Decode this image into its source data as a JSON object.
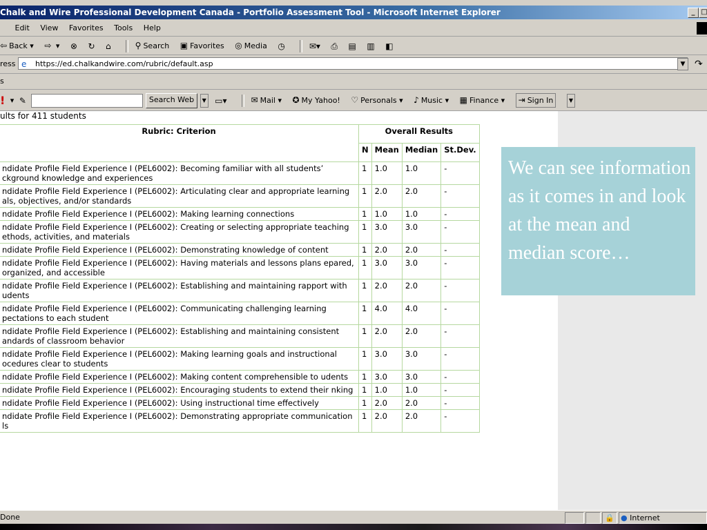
{
  "window": {
    "title": "Chalk and Wire Professional Development Canada - Portfolio Assessment Tool - Microsoft Internet Explorer",
    "minimize_label": "_",
    "restore_label": "□"
  },
  "menu": {
    "items": [
      "Edit",
      "View",
      "Favorites",
      "Tools",
      "Help"
    ]
  },
  "toolbar": {
    "back": "Back",
    "search": "Search",
    "favorites": "Favorites",
    "media": "Media"
  },
  "address": {
    "label": "ress",
    "url": "https://ed.chalkandwire.com/rubric/default.asp"
  },
  "links": {
    "label": "s"
  },
  "yahoo": {
    "search_button": "Search Web",
    "mail": "Mail",
    "my_yahoo": "My Yahoo!",
    "personals": "Personals",
    "music": "Music",
    "finance": "Finance",
    "sign_in": "Sign In"
  },
  "page": {
    "summary": "ults for 411 students",
    "criterion_header": "Rubric: Criterion",
    "overall_header": "Overall Results",
    "col_n": "N",
    "col_mean": "Mean",
    "col_median": "Median",
    "col_stdev": "St.Dev.",
    "rows": [
      {
        "criterion": "ndidate Profile Field Experience I (PEL6002): Becoming familiar with all students’ ckground knowledge and experiences",
        "n": "1",
        "mean": "1.0",
        "median": "1.0",
        "stdev": "-"
      },
      {
        "criterion": "ndidate Profile Field Experience I (PEL6002): Articulating clear and appropriate learning als, objectives, and/or standards",
        "n": "1",
        "mean": "2.0",
        "median": "2.0",
        "stdev": "-"
      },
      {
        "criterion": "ndidate Profile Field Experience I (PEL6002): Making learning connections",
        "n": "1",
        "mean": "1.0",
        "median": "1.0",
        "stdev": "-"
      },
      {
        "criterion": "ndidate Profile Field Experience I (PEL6002): Creating or selecting appropriate teaching ethods, activities, and materials",
        "n": "1",
        "mean": "3.0",
        "median": "3.0",
        "stdev": "-"
      },
      {
        "criterion": "ndidate Profile Field Experience I (PEL6002): Demonstrating knowledge of content",
        "n": "1",
        "mean": "2.0",
        "median": "2.0",
        "stdev": "-"
      },
      {
        "criterion": "ndidate Profile Field Experience I (PEL6002): Having materials and lessons plans epared, organized, and accessible",
        "n": "1",
        "mean": "3.0",
        "median": "3.0",
        "stdev": "-"
      },
      {
        "criterion": "ndidate Profile Field Experience I (PEL6002): Establishing and maintaining rapport with udents",
        "n": "1",
        "mean": "2.0",
        "median": "2.0",
        "stdev": "-"
      },
      {
        "criterion": "ndidate Profile Field Experience I (PEL6002): Communicating challenging learning pectations to each student",
        "n": "1",
        "mean": "4.0",
        "median": "4.0",
        "stdev": "-"
      },
      {
        "criterion": "ndidate Profile Field Experience I (PEL6002): Establishing and maintaining consistent andards of classroom behavior",
        "n": "1",
        "mean": "2.0",
        "median": "2.0",
        "stdev": "-"
      },
      {
        "criterion": "ndidate Profile Field Experience I (PEL6002): Making learning goals and instructional ocedures clear to students",
        "n": "1",
        "mean": "3.0",
        "median": "3.0",
        "stdev": "-"
      },
      {
        "criterion": "ndidate Profile Field Experience I (PEL6002): Making content comprehensible to udents",
        "n": "1",
        "mean": "3.0",
        "median": "3.0",
        "stdev": "-"
      },
      {
        "criterion": "ndidate Profile Field Experience I (PEL6002): Encouraging students to extend their nking",
        "n": "1",
        "mean": "1.0",
        "median": "1.0",
        "stdev": "-"
      },
      {
        "criterion": "ndidate Profile Field Experience I (PEL6002): Using instructional time effectively",
        "n": "1",
        "mean": "2.0",
        "median": "2.0",
        "stdev": "-"
      },
      {
        "criterion": "ndidate Profile Field Experience I (PEL6002): Demonstrating appropriate communication ls",
        "n": "1",
        "mean": "2.0",
        "median": "2.0",
        "stdev": "-"
      }
    ]
  },
  "callout": {
    "text": "We can see information as it comes in and look at the mean and median score…"
  },
  "status": {
    "left": "Done",
    "zone": "Internet"
  },
  "colors": {
    "table_border": "#b5d89f",
    "callout_bg": "#a6d2d8",
    "title_bar": "#0a246a"
  }
}
